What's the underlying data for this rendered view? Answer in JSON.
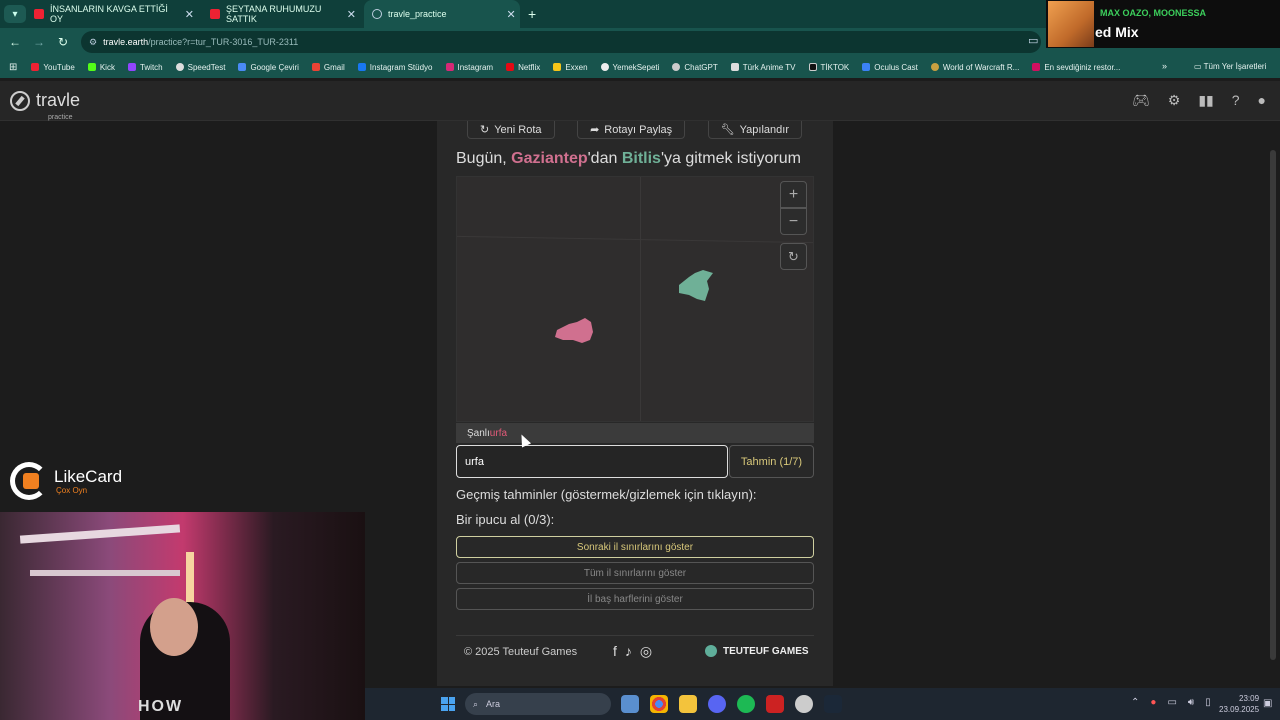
{
  "browser": {
    "tabs": [
      {
        "title": "İNSANLARIN KAVGA ETTİĞİ OY",
        "favicon": "youtube-icon"
      },
      {
        "title": "ŞEYTANA RUHUMUZU SATTIK",
        "favicon": "youtube-icon"
      },
      {
        "title": "travle_practice",
        "favicon": "compass-icon",
        "active": true
      }
    ],
    "url_host": "travle.earth",
    "url_path": "/practice?r=tur_TUR-3016_TUR-2311",
    "bookmarks": [
      "YouTube",
      "Kick",
      "Twitch",
      "SpeedTest",
      "Google Çeviri",
      "Gmail",
      "Instagram Stüdyo",
      "Instagram",
      "Netflix",
      "Exxen",
      "YemekSepeti",
      "ChatGPT",
      "Türk Anime TV",
      "TİKTOK",
      "Oculus Cast",
      "World of Warcraft R...",
      "En sevdiğiniz restor..."
    ],
    "bookmarks_all": "Tüm Yer İşaretleri"
  },
  "music": {
    "artist": "MAX OAZO, MOONESSA",
    "title": "ed Mix"
  },
  "app": {
    "logo_name": "travle",
    "logo_sub": "practice",
    "buttons": {
      "new_route": "Yeni Rota",
      "share_route": "Rotayı Paylaş",
      "configure": "Yapılandır"
    },
    "prompt": {
      "pre": "Bugün, ",
      "from": "Gaziantep",
      "mid": "'dan ",
      "to": "Bitlis",
      "post": "'ya gitmek istiyorum"
    },
    "suggestion": {
      "pre": "Şanlı",
      "highlight": "urfa"
    },
    "input_value": "urfa",
    "guess_button": "Tahmin (1/7)",
    "history_label": "Geçmiş tahminler (göstermek/gizlemek için tıklayın):",
    "hint_label": "Bir ipucu al (0/3):",
    "hints": [
      "Sonraki il sınırlarını göster",
      "Tüm il sınırlarını göster",
      "İl baş harflerini göster"
    ],
    "copyright": "© 2025 Teuteuf Games",
    "brand": "TEUTEUF GAMES",
    "colors": {
      "from": "#d0708f",
      "to": "#6fb097",
      "accent": "#d8c87a"
    }
  },
  "overlay": {
    "likecard_name": "LikeCard",
    "likecard_sub": "Çox Oyn",
    "shirt": "HOW"
  },
  "taskbar": {
    "search": "Ara",
    "time": "23:09",
    "date": "23.09.2025"
  }
}
